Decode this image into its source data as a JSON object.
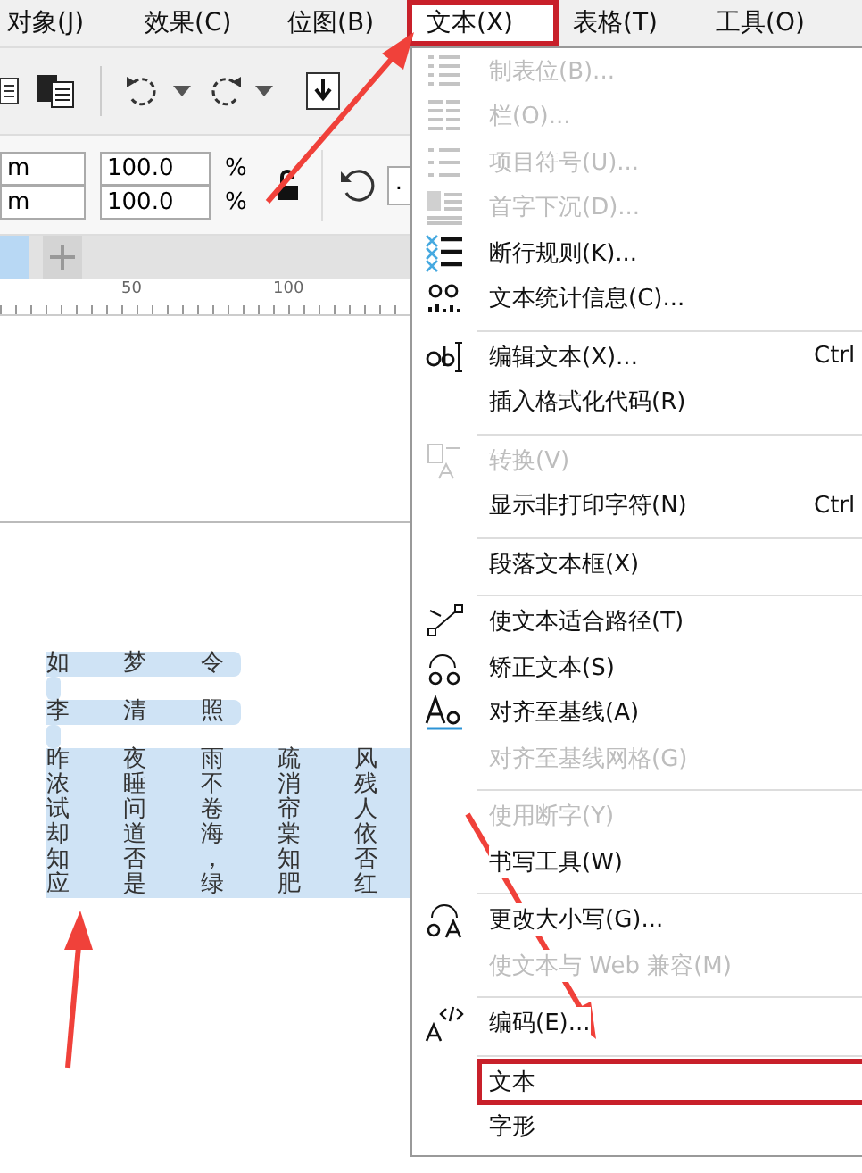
{
  "menu_bar": [
    {
      "label": "对象(J)",
      "selected": false,
      "marked": false
    },
    {
      "label": "效果(C)",
      "selected": false,
      "marked": false
    },
    {
      "label": "位图(B)",
      "selected": false,
      "marked": false
    },
    {
      "label": "文本(X)",
      "selected": true,
      "marked": true
    },
    {
      "label": "表格(T)",
      "selected": false,
      "marked": false
    },
    {
      "label": "工具(O)",
      "selected": false,
      "marked": false
    }
  ],
  "property_bar": {
    "size_fields": [
      "m",
      "m"
    ],
    "scale_fields": [
      "100.0",
      "100.0"
    ],
    "unit_labels": [
      "%",
      "%"
    ],
    "angle_field": "."
  },
  "ruler": {
    "labels": [
      "50",
      "100"
    ]
  },
  "poem": {
    "title": "如 梦 令",
    "author": "李 清 照",
    "verses": [
      "昨 夜 雨 疏 风",
      "浓 睡 不 消 残",
      "试 问 卷 帘 人",
      "却 道 海 棠 依",
      "知 否 ， 知 否",
      "应 是 绿 肥 红"
    ]
  },
  "text_menu": {
    "items": [
      {
        "kind": "item",
        "label": "制表位(B)...",
        "disabled": true,
        "marked": false
      },
      {
        "kind": "item",
        "label": "栏(O)...",
        "disabled": true,
        "marked": false
      },
      {
        "kind": "item",
        "label": "项目符号(U)...",
        "disabled": true,
        "marked": false
      },
      {
        "kind": "item",
        "label": "首字下沉(D)...",
        "disabled": true,
        "marked": false
      },
      {
        "kind": "item",
        "label": "断行规则(K)...",
        "disabled": false,
        "marked": false
      },
      {
        "kind": "item",
        "label": "文本统计信息(C)...",
        "disabled": false,
        "marked": false
      },
      {
        "kind": "separator"
      },
      {
        "kind": "item",
        "label": "编辑文本(X)...",
        "shortcut": "Ctrl",
        "disabled": false,
        "marked": false
      },
      {
        "kind": "item",
        "label": "插入格式化代码(R)",
        "disabled": false,
        "marked": false
      },
      {
        "kind": "separator"
      },
      {
        "kind": "item",
        "label": "转换(V)",
        "disabled": true,
        "marked": false
      },
      {
        "kind": "item",
        "label": "显示非打印字符(N)",
        "shortcut": "Ctrl",
        "disabled": false,
        "marked": false
      },
      {
        "kind": "separator"
      },
      {
        "kind": "item",
        "label": "段落文本框(X)",
        "disabled": false,
        "marked": false
      },
      {
        "kind": "separator"
      },
      {
        "kind": "item",
        "label": "使文本适合路径(T)",
        "disabled": false,
        "marked": false
      },
      {
        "kind": "item",
        "label": "矫正文本(S)",
        "disabled": false,
        "marked": false
      },
      {
        "kind": "item",
        "label": "对齐至基线(A)",
        "disabled": false,
        "marked": false
      },
      {
        "kind": "item",
        "label": "对齐至基线网格(G)",
        "disabled": true,
        "marked": false
      },
      {
        "kind": "separator"
      },
      {
        "kind": "item",
        "label": "使用断字(Y)",
        "disabled": true,
        "marked": false
      },
      {
        "kind": "item",
        "label": "书写工具(W)",
        "disabled": false,
        "marked": false
      },
      {
        "kind": "separator"
      },
      {
        "kind": "item",
        "label": "更改大小写(G)...",
        "disabled": false,
        "marked": false
      },
      {
        "kind": "item",
        "label": "使文本与 Web 兼容(M)",
        "disabled": true,
        "marked": false
      },
      {
        "kind": "separator"
      },
      {
        "kind": "item",
        "label": "编码(E)...",
        "disabled": false,
        "marked": false
      },
      {
        "kind": "separator"
      },
      {
        "kind": "item",
        "label": "文本",
        "disabled": false,
        "marked": true
      },
      {
        "kind": "item",
        "label": "字形",
        "disabled": false,
        "marked": false
      }
    ]
  }
}
